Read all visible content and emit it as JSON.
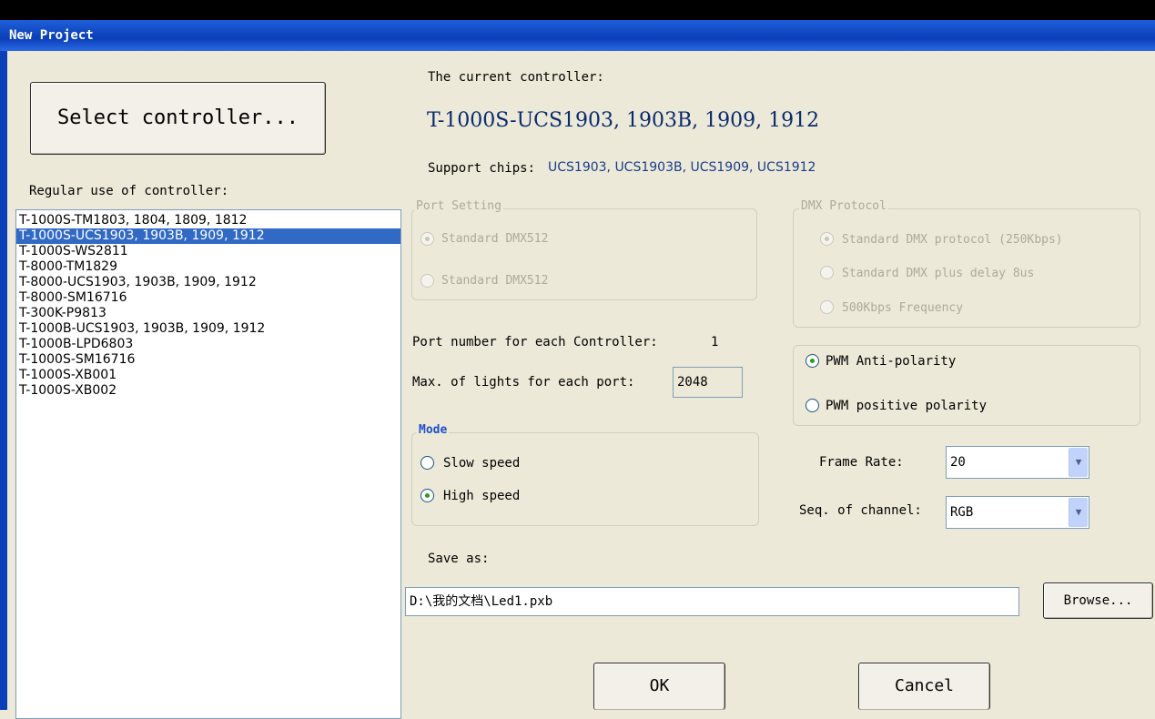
{
  "window": {
    "title": "New Project"
  },
  "left": {
    "select_button": "Select controller...",
    "list_label": "Regular use of controller:",
    "controllers": [
      "T-1000S-TM1803, 1804, 1809, 1812",
      "T-1000S-UCS1903, 1903B, 1909, 1912",
      "T-1000S-WS2811",
      "T-8000-TM1829",
      "T-8000-UCS1903, 1903B, 1909, 1912",
      "T-8000-SM16716",
      "T-300K-P9813",
      "T-1000B-UCS1903, 1903B, 1909, 1912",
      "T-1000B-LPD6803",
      "T-1000S-SM16716",
      "T-1000S-XB001",
      "T-1000S-XB002"
    ],
    "selected_index": 1
  },
  "current": {
    "label": "The current controller:",
    "name": "T-1000S-UCS1903, 1903B, 1909, 1912",
    "chips_label": "Support chips:",
    "chips": "UCS1903, UCS1903B, UCS1909, UCS1912"
  },
  "port_setting": {
    "legend": "Port Setting",
    "options": [
      "Standard DMX512",
      "Standard DMX512"
    ],
    "selected": 0
  },
  "dmx": {
    "legend": "DMX Protocol",
    "options": [
      "Standard DMX protocol (250Kbps)",
      "Standard DMX plus delay 8us",
      "500Kbps Frequency"
    ],
    "selected": 0
  },
  "ports": {
    "label": "Port number for each Controller:",
    "value": "1",
    "max_label": "Max. of lights for each port:",
    "max_value": "2048"
  },
  "polarity": {
    "options": [
      "PWM Anti-polarity",
      "PWM positive polarity"
    ],
    "selected": 0
  },
  "mode": {
    "legend": "Mode",
    "options": [
      "Slow speed",
      "High speed"
    ],
    "selected": 1
  },
  "frame_rate": {
    "label": "Frame Rate:",
    "value": "20"
  },
  "channel": {
    "label": "Seq. of channel:",
    "value": "RGB"
  },
  "save": {
    "label": "Save as:",
    "path": "D:\\我的文档\\Led1.pxb",
    "browse": "Browse..."
  },
  "buttons": {
    "ok": "OK",
    "cancel": "Cancel"
  },
  "colors": {
    "title_bar": "#0a3fb8",
    "selection": "#316ac5",
    "heading": "#0a2a6e",
    "accent_text": "#1a3d8a"
  }
}
